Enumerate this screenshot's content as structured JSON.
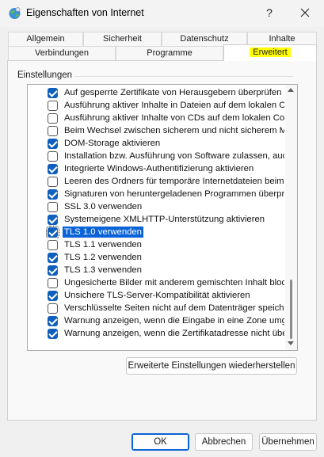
{
  "window": {
    "title": "Eigenschaften von Internet",
    "help": "?"
  },
  "tabs_row1": [
    "Allgemein",
    "Sicherheit",
    "Datenschutz",
    "Inhalte"
  ],
  "tabs_row2": [
    "Verbindungen",
    "Programme",
    "Erweitert"
  ],
  "active_tab": "Erweitert",
  "group_label": "Einstellungen",
  "settings": [
    {
      "label": "Auf gesperrte Zertifikate von Herausgebern überprüfen",
      "checked": true
    },
    {
      "label": "Ausführung aktiver Inhalte in Dateien auf dem lokalen Com",
      "checked": false
    },
    {
      "label": "Ausführung aktiver Inhalte von CDs auf dem lokalen Comp",
      "checked": false
    },
    {
      "label": "Beim Wechsel zwischen sicherem und nicht sicherem Modu",
      "checked": false
    },
    {
      "label": "DOM-Storage aktivieren",
      "checked": true
    },
    {
      "label": "Installation bzw. Ausführung von Software zulassen, auch",
      "checked": false
    },
    {
      "label": "Integrierte Windows-Authentifizierung aktivieren",
      "checked": true
    },
    {
      "label": "Leeren des Ordners für temporäre Internetdateien beim S",
      "checked": false
    },
    {
      "label": "Signaturen von heruntergeladenen Programmen überprüfe",
      "checked": true
    },
    {
      "label": "SSL 3.0 verwenden",
      "checked": false
    },
    {
      "label": "Systemeigene XMLHTTP-Unterstützung aktivieren",
      "checked": true
    },
    {
      "label": "TLS 1.0 verwenden",
      "checked": true,
      "selected": true
    },
    {
      "label": "TLS 1.1 verwenden",
      "checked": false
    },
    {
      "label": "TLS 1.2 verwenden",
      "checked": true
    },
    {
      "label": "TLS 1.3 verwenden",
      "checked": true
    },
    {
      "label": "Ungesicherte Bilder mit anderem gemischten Inhalt blockie",
      "checked": false
    },
    {
      "label": "Unsichere TLS-Server-Kompatibilität aktivieren",
      "checked": true
    },
    {
      "label": "Verschlüsselte Seiten nicht auf dem Datenträger speichern",
      "checked": false
    },
    {
      "label": "Warnung anzeigen, wenn die Eingabe in eine Zone umgele",
      "checked": true
    },
    {
      "label": "Warnung anzeigen, wenn die Zertifikatadresse nicht übere",
      "checked": true
    }
  ],
  "buttons": {
    "restore": "Erweiterte Einstellungen wiederherstellen",
    "ok": "OK",
    "cancel": "Abbrechen",
    "apply": "Übernehmen"
  },
  "colors": {
    "accent": "#0a64d7",
    "checkbox": "#0f5fbd",
    "highlight": "#ffff00"
  },
  "icons": {
    "app": "internet-options-globe-icon",
    "close": "close-icon"
  }
}
